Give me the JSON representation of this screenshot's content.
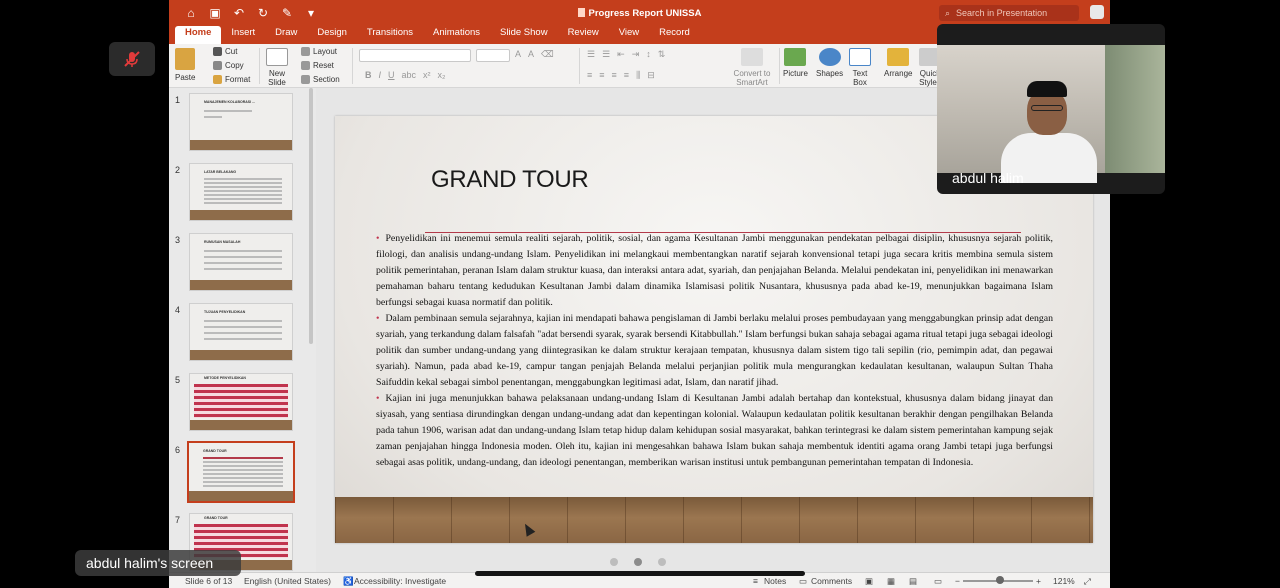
{
  "window": {
    "doc_title": "Progress Report UNISSA",
    "search_placeholder": "Search in Presentation"
  },
  "ribbon_tabs": [
    "Home",
    "Insert",
    "Draw",
    "Design",
    "Transitions",
    "Animations",
    "Slide Show",
    "Review",
    "View",
    "Record"
  ],
  "ribbon": {
    "paste": "Paste",
    "cut": "Cut",
    "copy": "Copy",
    "format": "Format",
    "new_slide": "New\nSlide",
    "layout": "Layout",
    "reset": "Reset",
    "section": "Section",
    "convert_smartart": "Convert to\nSmartArt",
    "picture": "Picture",
    "shapes": "Shapes",
    "text_box": "Text\nBox",
    "arrange": "Arrange",
    "quick_styles": "Quick\nStyles"
  },
  "thumbnails": [
    {
      "num": "1",
      "title": "MANAJEMEN KOLABORASI ..."
    },
    {
      "num": "2",
      "title": "LATAR BELAKANG"
    },
    {
      "num": "3",
      "title": "RUMUSAN MASALAH"
    },
    {
      "num": "4",
      "title": "TUJUAN PENYELIDIKAN"
    },
    {
      "num": "5",
      "title": "METODE PENYELIDIKAN"
    },
    {
      "num": "6",
      "title": "GRAND TOUR"
    },
    {
      "num": "7",
      "title": "GRAND TOUR"
    }
  ],
  "selected_slide": 6,
  "slide": {
    "title": "GRAND TOUR",
    "bullets": [
      "Penyelidikan ini menemui semula realiti sejarah, politik, sosial, dan agama Kesultanan Jambi menggunakan pendekatan pelbagai disiplin, khususnya sejarah politik, filologi, dan analisis undang-undang Islam. Penyelidikan ini melangkaui membentangkan naratif sejarah konvensional tetapi juga secara kritis membina semula sistem politik pemerintahan, peranan Islam dalam struktur kuasa, dan interaksi antara adat, syariah, dan penjajahan Belanda. Melalui pendekatan ini, penyelidikan ini menawarkan pemahaman baharu tentang kedudukan Kesultanan Jambi dalam dinamika Islamisasi politik Nusantara, khususnya pada abad ke-19, menunjukkan bagaimana Islam berfungsi sebagai kuasa normatif dan politik.",
      "Dalam pembinaan semula sejarahnya, kajian ini mendapati bahawa pengislaman di Jambi berlaku melalui proses pembudayaan yang menggabungkan prinsip adat dengan syariah, yang terkandung dalam falsafah \"adat bersendi syarak, syarak bersendi Kitabbullah.\" Islam berfungsi bukan sahaja sebagai agama ritual tetapi juga sebagai ideologi politik dan sumber undang-undang yang diintegrasikan ke dalam struktur kerajaan tempatan, khususnya dalam sistem tigo tali sepilin (rio, pemimpin adat, dan pegawai syariah). Namun, pada abad ke-19, campur tangan penjajah Belanda melalui perjanjian politik mula mengurangkan kedaulatan kesultanan, walaupun Sultan Thaha Saifuddin kekal sebagai simbol penentangan, menggabungkan legitimasi adat, Islam, dan naratif jihad.",
      "Kajian ini juga menunjukkan bahawa pelaksanaan undang-undang Islam di Kesultanan Jambi adalah bertahap dan kontekstual, khususnya dalam bidang jinayat dan siyasah, yang sentiasa dirundingkan dengan undang-undang adat dan kepentingan kolonial. Walaupun kedaulatan politik kesultanan berakhir dengan pengilhakan Belanda pada tahun 1906, warisan adat dan undang-undang Islam tetap hidup dalam kehidupan sosial masyarakat, bahkan terintegrasi ke dalam sistem pemerintahan kampung sejak zaman penjajahan hingga Indonesia moden. Oleh itu, kajian ini mengesahkan bahawa Islam bukan sahaja membentuk identiti agama orang Jambi tetapi juga berfungsi sebagai asas politik, undang-undang, dan ideologi penentangan, memberikan warisan institusi untuk pembangunan pemerintahan tempatan di Indonesia."
    ]
  },
  "status_bar": {
    "slide_counter": "Slide 6 of 13",
    "language": "English (United States)",
    "accessibility": "Accessibility: Investigate",
    "notes": "Notes",
    "comments": "Comments",
    "zoom": "121%"
  },
  "meeting": {
    "participant_name": "abdul halim",
    "screen_label": "abdul halim's screen"
  }
}
